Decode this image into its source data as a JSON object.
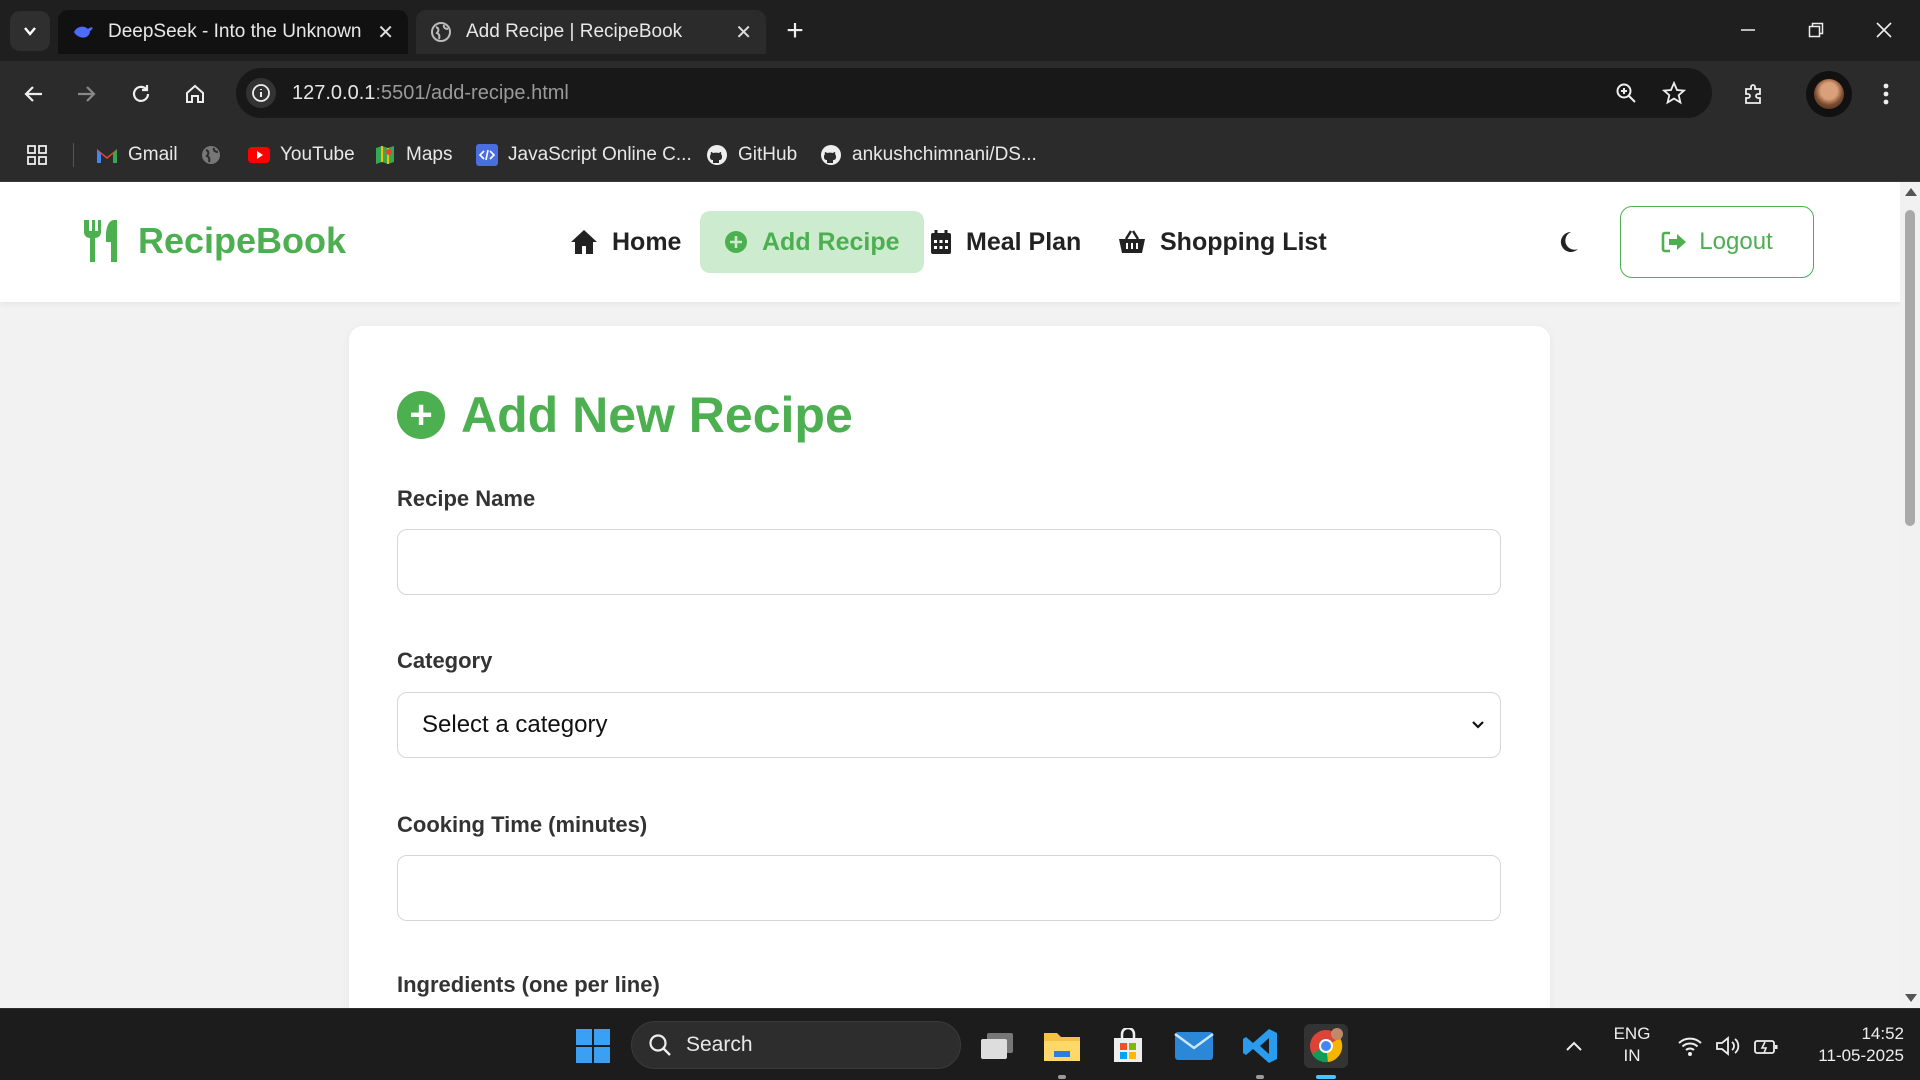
{
  "browser": {
    "tabs": [
      {
        "title": "DeepSeek - Into the Unknown",
        "active": false
      },
      {
        "title": "Add Recipe | RecipeBook",
        "active": true
      }
    ],
    "url_host": "127.0.0.1",
    "url_rest": ":5501/add-recipe.html",
    "bookmarks": [
      "Gmail",
      "YouTube",
      "Maps",
      "JavaScript Online C...",
      "GitHub",
      "ankushchimnani/DS..."
    ]
  },
  "site": {
    "brand": "RecipeBook",
    "nav": [
      {
        "label": "Home",
        "icon": "home-icon",
        "active": false
      },
      {
        "label": "Add Recipe",
        "icon": "plus-circle-icon",
        "active": true
      },
      {
        "label": "Meal Plan",
        "icon": "calendar-icon",
        "active": false
      },
      {
        "label": "Shopping List",
        "icon": "basket-icon",
        "active": false
      }
    ],
    "logout_label": "Logout"
  },
  "form": {
    "title": "Add New Recipe",
    "fields": [
      {
        "label": "Recipe Name",
        "type": "text",
        "value": ""
      },
      {
        "label": "Category",
        "type": "select",
        "value": "Select a category"
      },
      {
        "label": "Cooking Time (minutes)",
        "type": "number",
        "value": ""
      },
      {
        "label": "Ingredients (one per line)",
        "type": "textarea",
        "value": ""
      }
    ]
  },
  "taskbar": {
    "search_label": "Search",
    "language": "ENG",
    "region": "IN",
    "time": "14:52",
    "date": "11-05-2025"
  },
  "colors": {
    "accent": "#4caf50",
    "accent_soft": "#cdeccf",
    "page_bg": "#f2f2f2",
    "chrome_dark": "#1f1f1f"
  }
}
